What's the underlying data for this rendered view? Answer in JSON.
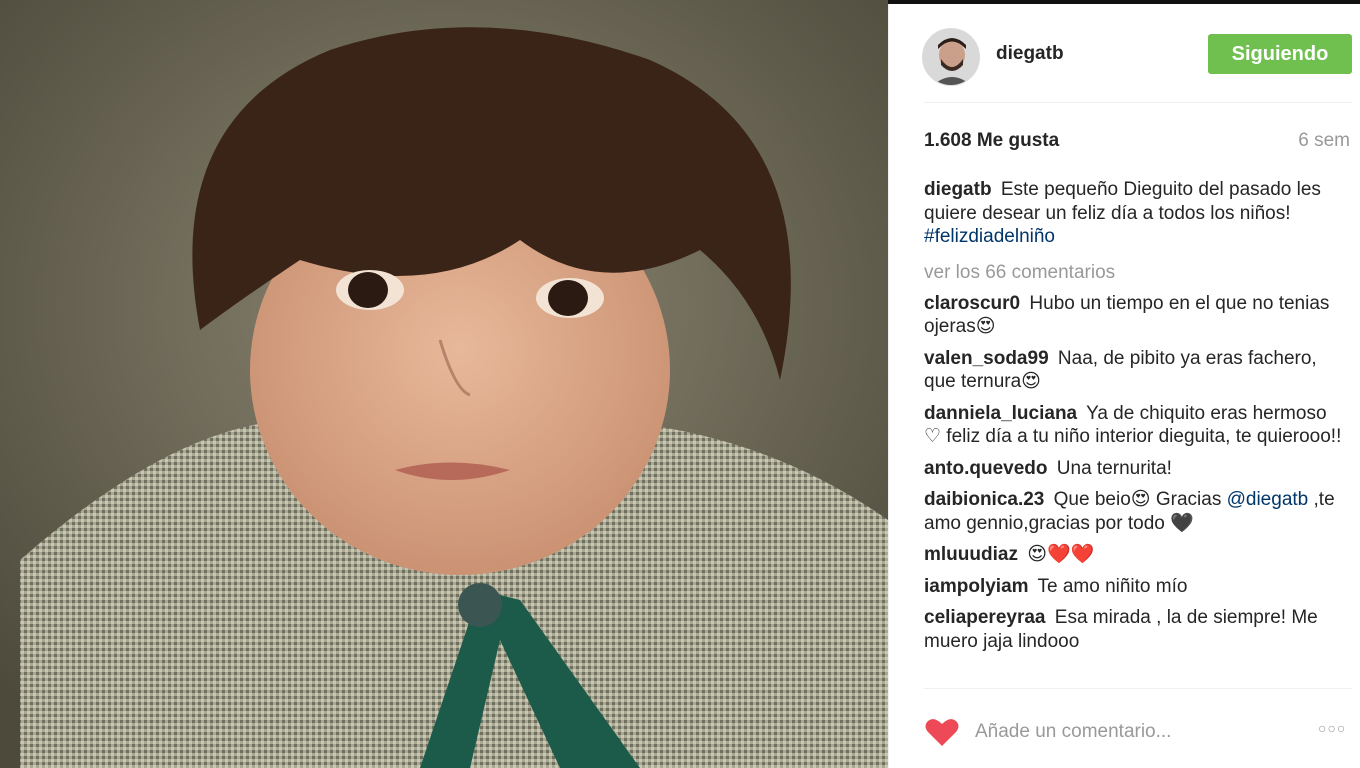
{
  "post": {
    "username": "diegatb",
    "follow_label": "Siguiendo",
    "likes": "1.608 Me gusta",
    "time_ago": "6 sem",
    "caption_text": "Este pequeño Dieguito del pasado les quiere desear un feliz día a todos los niños!",
    "caption_hashtag": "#felizdiadelniño",
    "view_all": "ver los 66 comentarios",
    "add_comment_placeholder": "Añade un comentario...",
    "more_label": "○○○"
  },
  "comments": [
    {
      "user": "claroscur0",
      "text": "Hubo un tiempo en el que no tenias ojeras😍"
    },
    {
      "user": "valen_soda99",
      "text": "Naa, de pibito ya eras fachero, que ternura😍"
    },
    {
      "user": "danniela_luciana",
      "text": "Ya de chiquito eras hermoso ♡ feliz día a tu niño interior dieguita, te quierooo!!"
    },
    {
      "user": "anto.quevedo",
      "text": "Una ternurita!"
    },
    {
      "user": "daibionica.23",
      "text_before": "Que beio😍 Gracias",
      "mention": "@diegatb",
      "text_after": ",te amo gennio,gracias por todo 🖤"
    },
    {
      "user": "mluuudiaz",
      "text": "😍❤️❤️"
    },
    {
      "user": "iampolyiam",
      "text": "Te amo niñito mío"
    },
    {
      "user": "celiapereyraa",
      "text": "Esa mirada , la de siempre! Me muero jaja lindooo"
    }
  ],
  "colors": {
    "follow_button": "#70c050",
    "heart": "#ed4956",
    "link": "#003569"
  },
  "icons": {
    "like": "heart-icon",
    "more": "more-options-icon"
  }
}
